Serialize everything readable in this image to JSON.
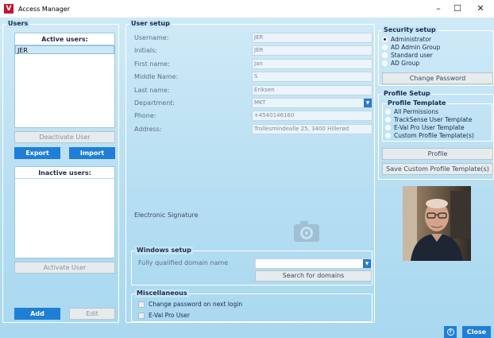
{
  "window": {
    "title": "Access Manager",
    "logo_letter": "V",
    "minimize": "–",
    "maximize": "☐",
    "close": "✕"
  },
  "users": {
    "legend": "Users",
    "active_header": "Active users:",
    "active_list": [
      "JER"
    ],
    "deactivate_label": "Deactivate User",
    "export_label": "Export",
    "import_label": "Import",
    "inactive_header": "Inactive users:",
    "activate_label": "Activate User",
    "add_label": "Add",
    "edit_label": "Edit"
  },
  "user_setup": {
    "legend": "User setup",
    "fields": {
      "username": {
        "label": "Username:",
        "value": "JER"
      },
      "initials": {
        "label": "Initials:",
        "value": "JER"
      },
      "first_name": {
        "label": "First name:",
        "value": "Jan"
      },
      "middle_name": {
        "label": "Middle Name:",
        "value": "S"
      },
      "last_name": {
        "label": "Last name:",
        "value": "Eriksen"
      },
      "department": {
        "label": "Department:",
        "value": "MKT"
      },
      "phone": {
        "label": "Phone:",
        "value": "+4540146160"
      },
      "address": {
        "label": "Address:",
        "value": "Trollesmindealle 25, 3400 Hillerød"
      }
    },
    "signature_label": "Electronic Signature"
  },
  "windows_setup": {
    "legend": "Windows setup",
    "domain_label": "Fully qualified domain name",
    "domain_value": "",
    "search_label": "Search for domains"
  },
  "misc": {
    "legend": "Miscellaneous",
    "change_pw_label": "Change password on next login",
    "eval_pro_label": "E-Val Pro User"
  },
  "security_setup": {
    "legend": "Security setup",
    "options": [
      "Administrator",
      "AD Admin Group",
      "Standard user",
      "AD Group"
    ],
    "selected_index": 0,
    "change_password_label": "Change Password"
  },
  "profile_setup": {
    "legend": "Profile Setup",
    "template_legend": "Profile Template",
    "templates": [
      "All Permissions",
      "TrackSense User Template",
      "E-Val Pro User Template",
      "Custom Profile Template(s)"
    ],
    "profile_label": "Profile",
    "save_custom_label": "Save Custom Profile Template(s)"
  },
  "footer": {
    "help_icon": "?",
    "close_label": "Close"
  },
  "colors": {
    "accent": "#1f7fd6",
    "brand": "#c4122f",
    "background": "#b6def2"
  }
}
